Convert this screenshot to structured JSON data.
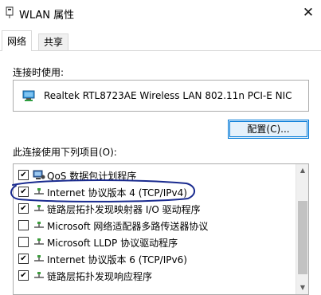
{
  "window": {
    "title": "WLAN 属性",
    "close_glyph": "✕"
  },
  "tabs": [
    {
      "label": "网络",
      "active": true
    },
    {
      "label": "共享",
      "active": false
    }
  ],
  "connect_using": {
    "label": "连接时使用:",
    "adapter_name": "Realtek RTL8723AE Wireless LAN 802.11n PCI-E NIC",
    "adapter_icon": "network-adapter-icon"
  },
  "configure_button": {
    "label": "配置(C)..."
  },
  "items_section": {
    "label": "此连接使用下列项目(O):",
    "items": [
      {
        "label": "QoS 数据包计划程序",
        "checked": true,
        "icon": "qos-scheduler-icon"
      },
      {
        "label": "Internet 协议版本 4 (TCP/IPv4)",
        "checked": true,
        "icon": "protocol-icon"
      },
      {
        "label": "链路层拓扑发现映射器 I/O 驱动程序",
        "checked": true,
        "icon": "protocol-icon"
      },
      {
        "label": "Microsoft 网络适配器多路传送器协议",
        "checked": false,
        "icon": "protocol-icon"
      },
      {
        "label": "Microsoft LLDP 协议驱动程序",
        "checked": false,
        "icon": "protocol-icon"
      },
      {
        "label": "Internet 协议版本 6 (TCP/IPv6)",
        "checked": true,
        "icon": "protocol-icon"
      },
      {
        "label": "链路层拓扑发现响应程序",
        "checked": true,
        "icon": "protocol-icon"
      }
    ]
  },
  "scrollbar": {
    "up_glyph": "▲",
    "down_glyph": "▼"
  },
  "colors": {
    "annotation_ink": "#1a2b8f",
    "focus_border": "#0078d7",
    "button_fill": "#e5f1fb"
  }
}
